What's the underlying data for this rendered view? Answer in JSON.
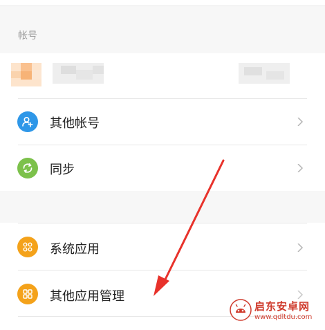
{
  "section": {
    "account_header": "帐号"
  },
  "rows": [
    {
      "label": "其他帐号",
      "icon": "user-add-icon",
      "color": "#2e97e8"
    },
    {
      "label": "同步",
      "icon": "sync-icon",
      "color": "#7cc14b"
    },
    {
      "label": "系统应用",
      "icon": "apps-grid-icon",
      "color": "#f4a21a"
    },
    {
      "label": "其他应用管理",
      "icon": "apps-grid-icon",
      "color": "#f4a21a"
    }
  ],
  "watermark": {
    "brand": "启东安卓网",
    "url": "www.qdltdu.com"
  },
  "colors": {
    "background": "#f7f7f7",
    "arrow": "#e8322b"
  }
}
